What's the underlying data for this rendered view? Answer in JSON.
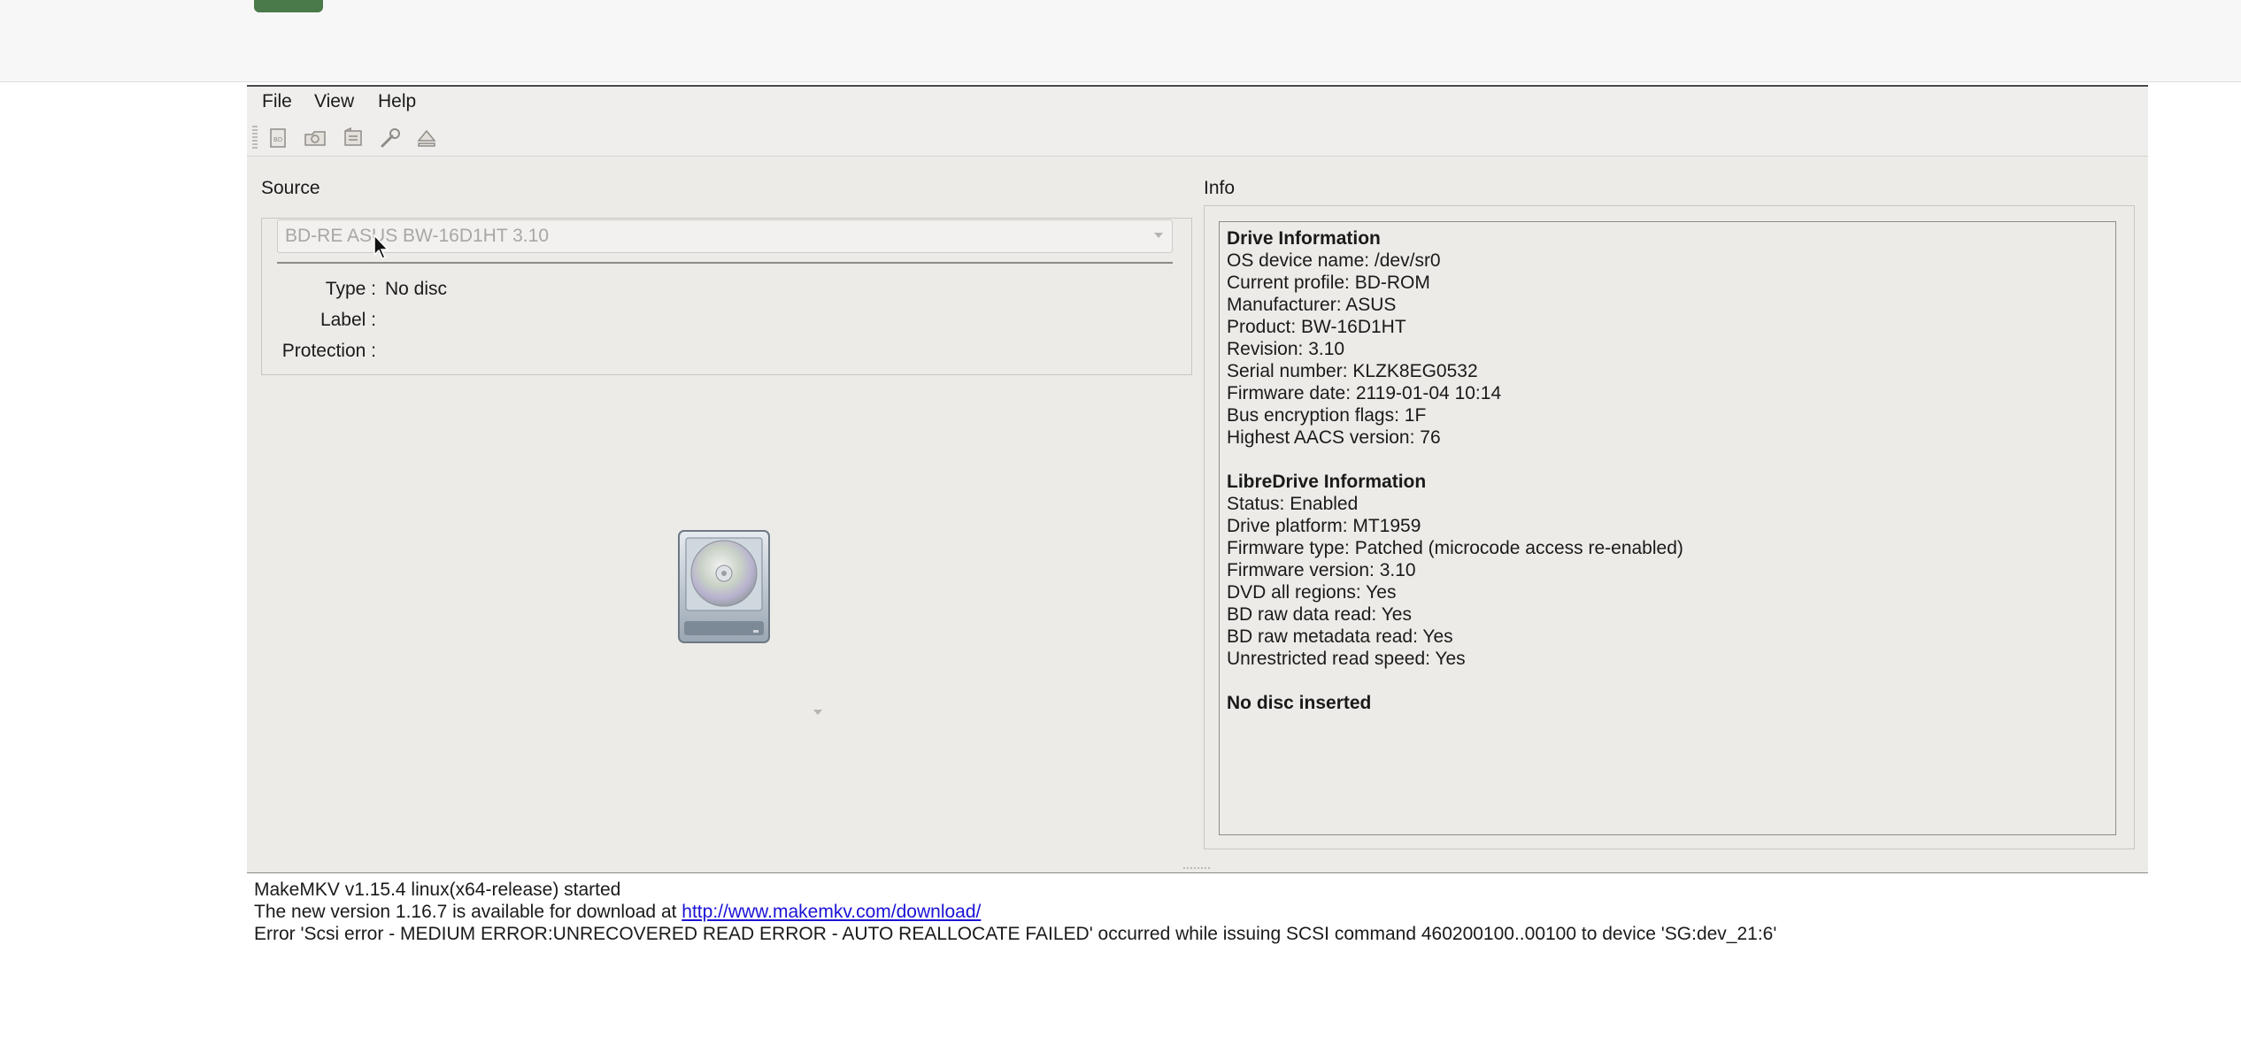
{
  "menu": {
    "file": "File",
    "view": "View",
    "help": "Help"
  },
  "toolbar": {
    "icons": [
      "open-files-icon",
      "open-disc-icon",
      "backup-icon",
      "preferences-icon",
      "eject-icon"
    ]
  },
  "source": {
    "label": "Source",
    "drive": "BD-RE ASUS BW-16D1HT 3.10",
    "type_label": "Type :",
    "type_value": "No disc",
    "label_label": "Label :",
    "label_value": "",
    "protection_label": "Protection :",
    "protection_value": ""
  },
  "info": {
    "label": "Info",
    "drive_heading": "Drive Information",
    "drive_lines": [
      "OS device name: /dev/sr0",
      "Current profile: BD-ROM",
      "Manufacturer: ASUS",
      "Product: BW-16D1HT",
      "Revision: 3.10",
      "Serial number: KLZK8EG0532",
      "Firmware date: 2119-01-04 10:14",
      "Bus encryption flags: 1F",
      "Highest AACS version: 76"
    ],
    "libre_heading": "LibreDrive Information",
    "libre_lines": [
      "Status: Enabled",
      "Drive platform: MT1959",
      "Firmware type: Patched (microcode access re-enabled)",
      "Firmware version: 3.10",
      "DVD all regions: Yes",
      "BD raw data read: Yes",
      "BD raw metadata read: Yes",
      "Unrestricted read speed: Yes"
    ],
    "disc_status": "No disc inserted"
  },
  "log": {
    "line1": "MakeMKV v1.15.4 linux(x64-release) started",
    "line2_prefix": "The new version 1.16.7 is available for download at ",
    "line2_link": "http://www.makemkv.com/download/",
    "line3": "Error 'Scsi error - MEDIUM ERROR:UNRECOVERED READ ERROR - AUTO REALLOCATE FAILED' occurred while issuing SCSI command 460200100..00100 to device 'SG:dev_21:6'"
  },
  "colors": {
    "window_bg": "#edebe8",
    "link": "#1a12d6",
    "accent_button": "#4a7a4a"
  }
}
